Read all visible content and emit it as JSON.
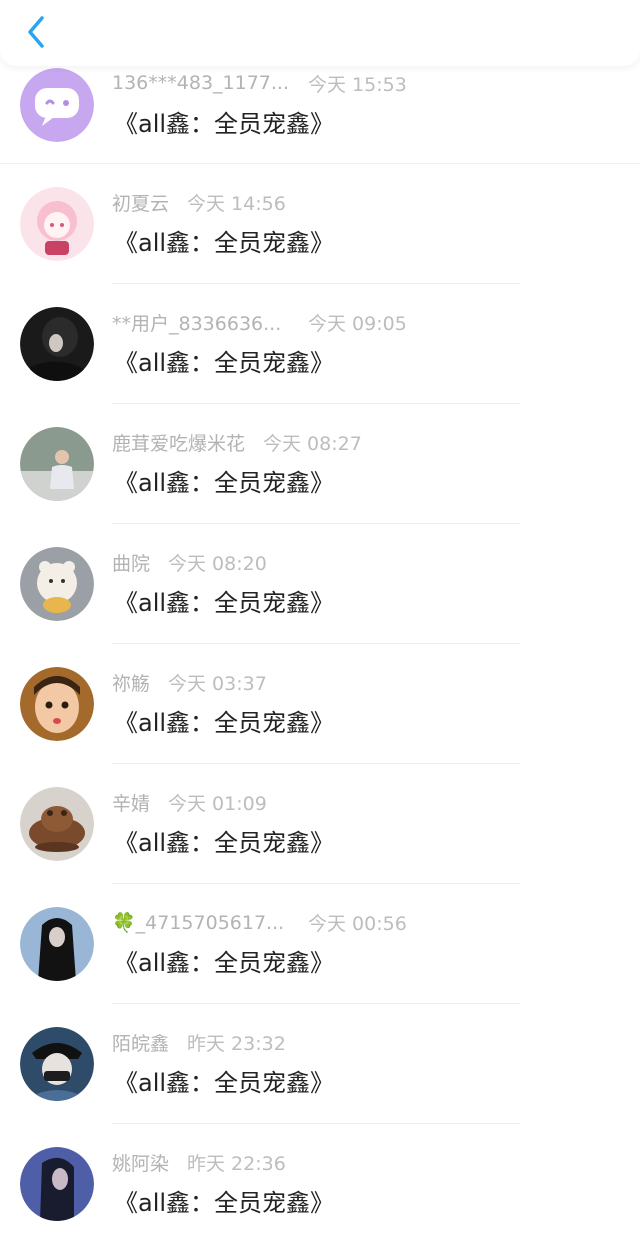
{
  "nav": {
    "back_icon": "chevron-left-icon"
  },
  "colors": {
    "accent": "#2aa3f2",
    "meta": "#b3b3b3",
    "message": "#222222",
    "divider": "#efefef"
  },
  "comments": [
    {
      "name": "136***483_1177...",
      "time": "今天 15:53",
      "message": "《all鑫：全员宠鑫》",
      "avatar": "chat-bubble-avatar"
    },
    {
      "name": "初夏云",
      "time": "今天 14:56",
      "message": "《all鑫：全员宠鑫》",
      "avatar": "anime-girl-avatar"
    },
    {
      "name": "**用户_8336636...",
      "time": "今天 09:05",
      "message": "《all鑫：全员宠鑫》",
      "avatar": "dark-hair-avatar"
    },
    {
      "name": "鹿茸爱吃爆米花",
      "time": "今天 08:27",
      "message": "《all鑫：全员宠鑫》",
      "avatar": "sitting-person-avatar"
    },
    {
      "name": "曲院",
      "time": "今天 08:20",
      "message": "《all鑫：全员宠鑫》",
      "avatar": "bear-avatar"
    },
    {
      "name": "祢觞",
      "time": "今天 03:37",
      "message": "《all鑫：全员宠鑫》",
      "avatar": "child-avatar"
    },
    {
      "name": "辛婧",
      "time": "今天 01:09",
      "message": "《all鑫：全员宠鑫》",
      "avatar": "frog-figurine-avatar"
    },
    {
      "name": "🍀_4715705617...",
      "time": "今天 00:56",
      "message": "《all鑫：全员宠鑫》",
      "avatar": "long-hair-avatar"
    },
    {
      "name": "陌皖鑫",
      "time": "昨天 23:32",
      "message": "《all鑫：全员宠鑫》",
      "avatar": "masked-avatar"
    },
    {
      "name": "姚阿染",
      "time": "昨天 22:36",
      "message": "《all鑫：全员宠鑫》",
      "avatar": "portrait-avatar"
    }
  ]
}
